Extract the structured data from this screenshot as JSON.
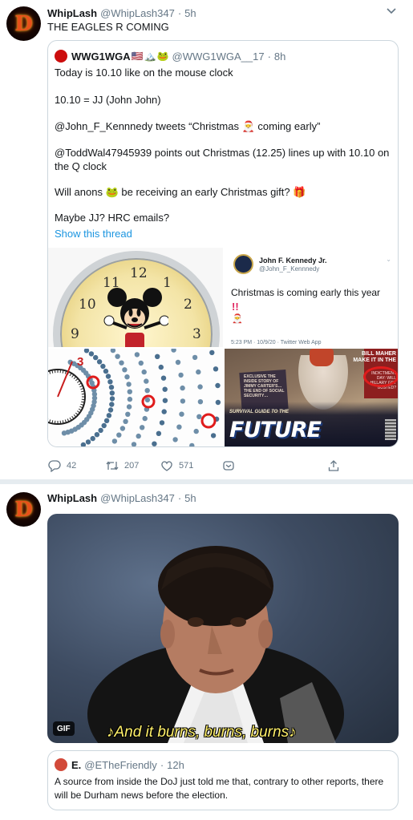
{
  "tweets": [
    {
      "avatar_letter": "D",
      "display_name": "WhipLash",
      "handle": "@WhipLash347",
      "separator": "·",
      "time": "5h",
      "text": "THE EAGLES R COMING",
      "quote": {
        "display_name": "WWG1WGA",
        "name_emoji": [
          "🇺🇸",
          "🏔️",
          "🐸"
        ],
        "handle": "@WWG1WGA__17",
        "separator": "·",
        "time": "8h",
        "lines": [
          "Today is 10.10 like on the mouse clock",
          "10.10 = JJ (John John)",
          "@John_F_Kennnedy tweets “Christmas 🎅 coming early”",
          "@ToddWal47945939 points out Christmas (12.25) lines up with 10.10 on the Q clock",
          "Will anons 🐸 be receiving an early Christmas gift? 🎁",
          "Maybe JJ? HRC emails?"
        ],
        "show_thread": "Show this thread",
        "media": {
          "clock_numbers": [
            "12",
            "11",
            "1",
            "10",
            "2",
            "9",
            "3"
          ],
          "embedded_tweet": {
            "name": "John F. Kennedy Jr.",
            "handle": "@John_F_Kennnedy",
            "text": "Christmas is coming early this year",
            "bangs": "!!",
            "emoji": "🎅",
            "meta": "5:23 PM · 10/9/20 · Twitter Web App"
          },
          "dial_number": "3",
          "meme": {
            "corner_title": "BILL MAHER\nMAKE IT IN THE",
            "corner_sub": "INDICTMENT DAY: WILL HILLARY GET BUSTED?",
            "paper_text": "EXCLUSIVE THE INSIDE STORY OF JIMMY CARTER'S… THE END OF SOCIAL SECURITY…",
            "small_text": "SURVIVAL GUIDE TO THE",
            "big_text": "FUTURE"
          }
        }
      },
      "actions": {
        "replies": "42",
        "retweets": "207",
        "likes": "571"
      }
    },
    {
      "avatar_letter": "D",
      "display_name": "WhipLash",
      "handle": "@WhipLash347",
      "separator": "·",
      "time": "5h",
      "gif_badge": "GIF",
      "caption": "♪And it burns, burns, burns♪",
      "quote": {
        "display_name": "E.",
        "handle": "@ETheFriendly",
        "separator": "·",
        "time": "12h",
        "text": "A source from inside the DoJ just told me that, contrary to other reports, there will be Durham news before the election."
      }
    }
  ],
  "colors": {
    "link": "#1b95e0",
    "secondary_text": "#657786",
    "border": "#ccd6dd",
    "divider": "#e6ecf0"
  },
  "icons": [
    "reply-icon",
    "retweet-icon",
    "like-icon",
    "share-dm-icon",
    "share-icon",
    "chevron-down-icon"
  ]
}
